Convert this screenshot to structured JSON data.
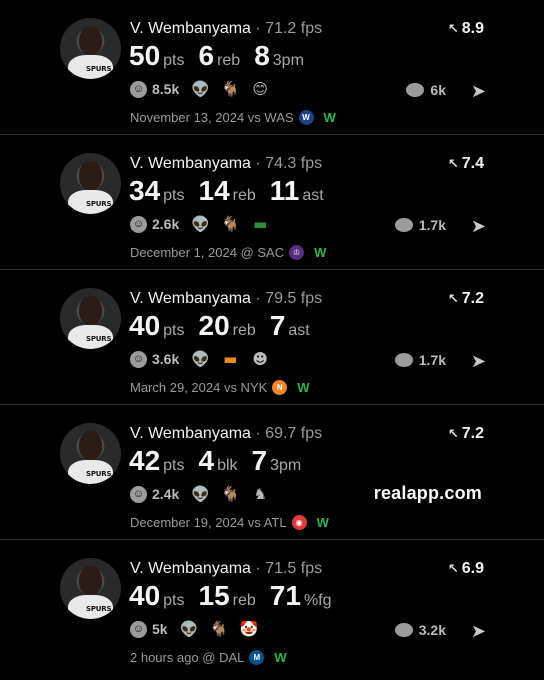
{
  "cards": [
    {
      "player": "V. Wembanyama",
      "fps": "· 71.2 fps",
      "rating": "8.9",
      "stats": [
        {
          "value": "50",
          "label": "pts"
        },
        {
          "value": "6",
          "label": "reb"
        },
        {
          "value": "8",
          "label": "3pm"
        }
      ],
      "reaction_count": "8.5k",
      "reaction_icons": [
        "alien-icon",
        "goat-icon",
        "face-icon"
      ],
      "comments": "6k",
      "date": "November 13, 2024 vs WAS",
      "opponent_logo": "wizards-logo",
      "opponent_color": "#1d428a",
      "result": "W"
    },
    {
      "player": "V. Wembanyama",
      "fps": "· 74.3 fps",
      "rating": "7.4",
      "stats": [
        {
          "value": "34",
          "label": "pts"
        },
        {
          "value": "14",
          "label": "reb"
        },
        {
          "value": "11",
          "label": "ast"
        }
      ],
      "reaction_count": "2.6k",
      "reaction_icons": [
        "alien-icon",
        "goat-icon",
        "flag-icon"
      ],
      "comments": "1.7k",
      "date": "December 1, 2024 @ SAC",
      "opponent_logo": "kings-logo",
      "opponent_color": "#5a2d81",
      "result": "W"
    },
    {
      "player": "V. Wembanyama",
      "fps": "· 79.5 fps",
      "rating": "7.2",
      "stats": [
        {
          "value": "40",
          "label": "pts"
        },
        {
          "value": "20",
          "label": "reb"
        },
        {
          "value": "7",
          "label": "ast"
        }
      ],
      "reaction_count": "3.6k",
      "reaction_icons": [
        "alien-icon",
        "flag-icon",
        "face-icon"
      ],
      "comments": "1.7k",
      "date": "March 29, 2024 vs NYK",
      "opponent_logo": "knicks-logo",
      "opponent_color": "#f58426",
      "result": "W"
    },
    {
      "player": "V. Wembanyama",
      "fps": "· 69.7 fps",
      "rating": "7.2",
      "stats": [
        {
          "value": "42",
          "label": "pts"
        },
        {
          "value": "4",
          "label": "blk"
        },
        {
          "value": "7",
          "label": "3pm"
        }
      ],
      "reaction_count": "2.4k",
      "reaction_icons": [
        "alien-icon",
        "goat-icon",
        "flex-icon"
      ],
      "watermark": "realapp.com",
      "date": "December 19, 2024 vs ATL",
      "opponent_logo": "hawks-logo",
      "opponent_color": "#e03a3e",
      "result": "W"
    },
    {
      "player": "V. Wembanyama",
      "fps": "· 71.5 fps",
      "rating": "6.9",
      "stats": [
        {
          "value": "40",
          "label": "pts"
        },
        {
          "value": "15",
          "label": "reb"
        },
        {
          "value": "71",
          "label": "%fg"
        }
      ],
      "reaction_count": "5k",
      "reaction_icons": [
        "alien-icon",
        "goat-icon",
        "clown-icon"
      ],
      "comments": "3.2k",
      "date": "2 hours ago @ DAL",
      "opponent_logo": "mavericks-logo",
      "opponent_color": "#00538c",
      "result": "W"
    }
  ],
  "colors": {
    "background": "#000000",
    "win": "#2fb34a",
    "muted": "#9a9a9a"
  }
}
